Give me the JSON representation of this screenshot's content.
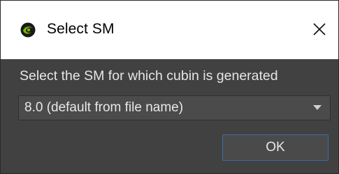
{
  "window": {
    "title": "Select SM",
    "icon": "nvidia-eye-icon"
  },
  "dialog": {
    "prompt": "Select the SM for which cubin is generated",
    "select": {
      "selected_value": "8.0 (default from file name)"
    },
    "ok_label": "OK"
  },
  "colors": {
    "titlebar_bg": "#ffffff",
    "body_bg": "#414141",
    "text": "#e6e6e6",
    "focus_border": "#3a6ea5",
    "icon_green": "#76b900"
  }
}
